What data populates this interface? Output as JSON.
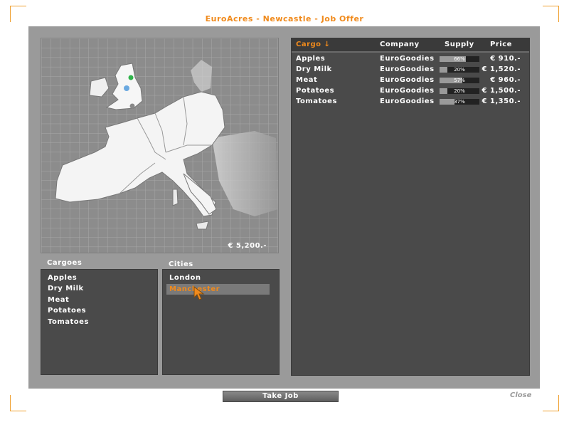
{
  "window": {
    "title": "EuroAcres - Newcastle - Job Offer"
  },
  "map": {
    "price": "€ 5,200.-"
  },
  "cargoes": {
    "label": "Cargoes",
    "items": [
      "Apples",
      "Dry Milk",
      "Meat",
      "Potatoes",
      "Tomatoes"
    ]
  },
  "cities": {
    "label": "Cities",
    "items": [
      "London",
      "Manchester"
    ],
    "selected": "Manchester"
  },
  "offers": {
    "headers": {
      "cargo": "Cargo ↓",
      "company": "Company",
      "supply": "Supply",
      "price": "Price"
    },
    "rows": [
      {
        "cargo": "Apples",
        "company": "EuroGoodies",
        "supply_pct": "66%",
        "supply": 0.66,
        "price": "€ 910.-"
      },
      {
        "cargo": "Dry Milk",
        "company": "EuroGoodies",
        "supply_pct": "20%",
        "supply": 0.2,
        "price": "€ 1,520.-"
      },
      {
        "cargo": "Meat",
        "company": "EuroGoodies",
        "supply_pct": "57%",
        "supply": 0.57,
        "price": "€ 960.-"
      },
      {
        "cargo": "Potatoes",
        "company": "EuroGoodies",
        "supply_pct": "20%",
        "supply": 0.2,
        "price": "€ 1,500.-"
      },
      {
        "cargo": "Tomatoes",
        "company": "EuroGoodies",
        "supply_pct": "37%",
        "supply": 0.37,
        "price": "€ 1,350.-"
      }
    ]
  },
  "buttons": {
    "take_job": "Take Job",
    "close": "Close"
  },
  "colors": {
    "accent": "#f08a1c",
    "panel": "#9a9a9a",
    "list_bg": "#4a4a4a"
  }
}
